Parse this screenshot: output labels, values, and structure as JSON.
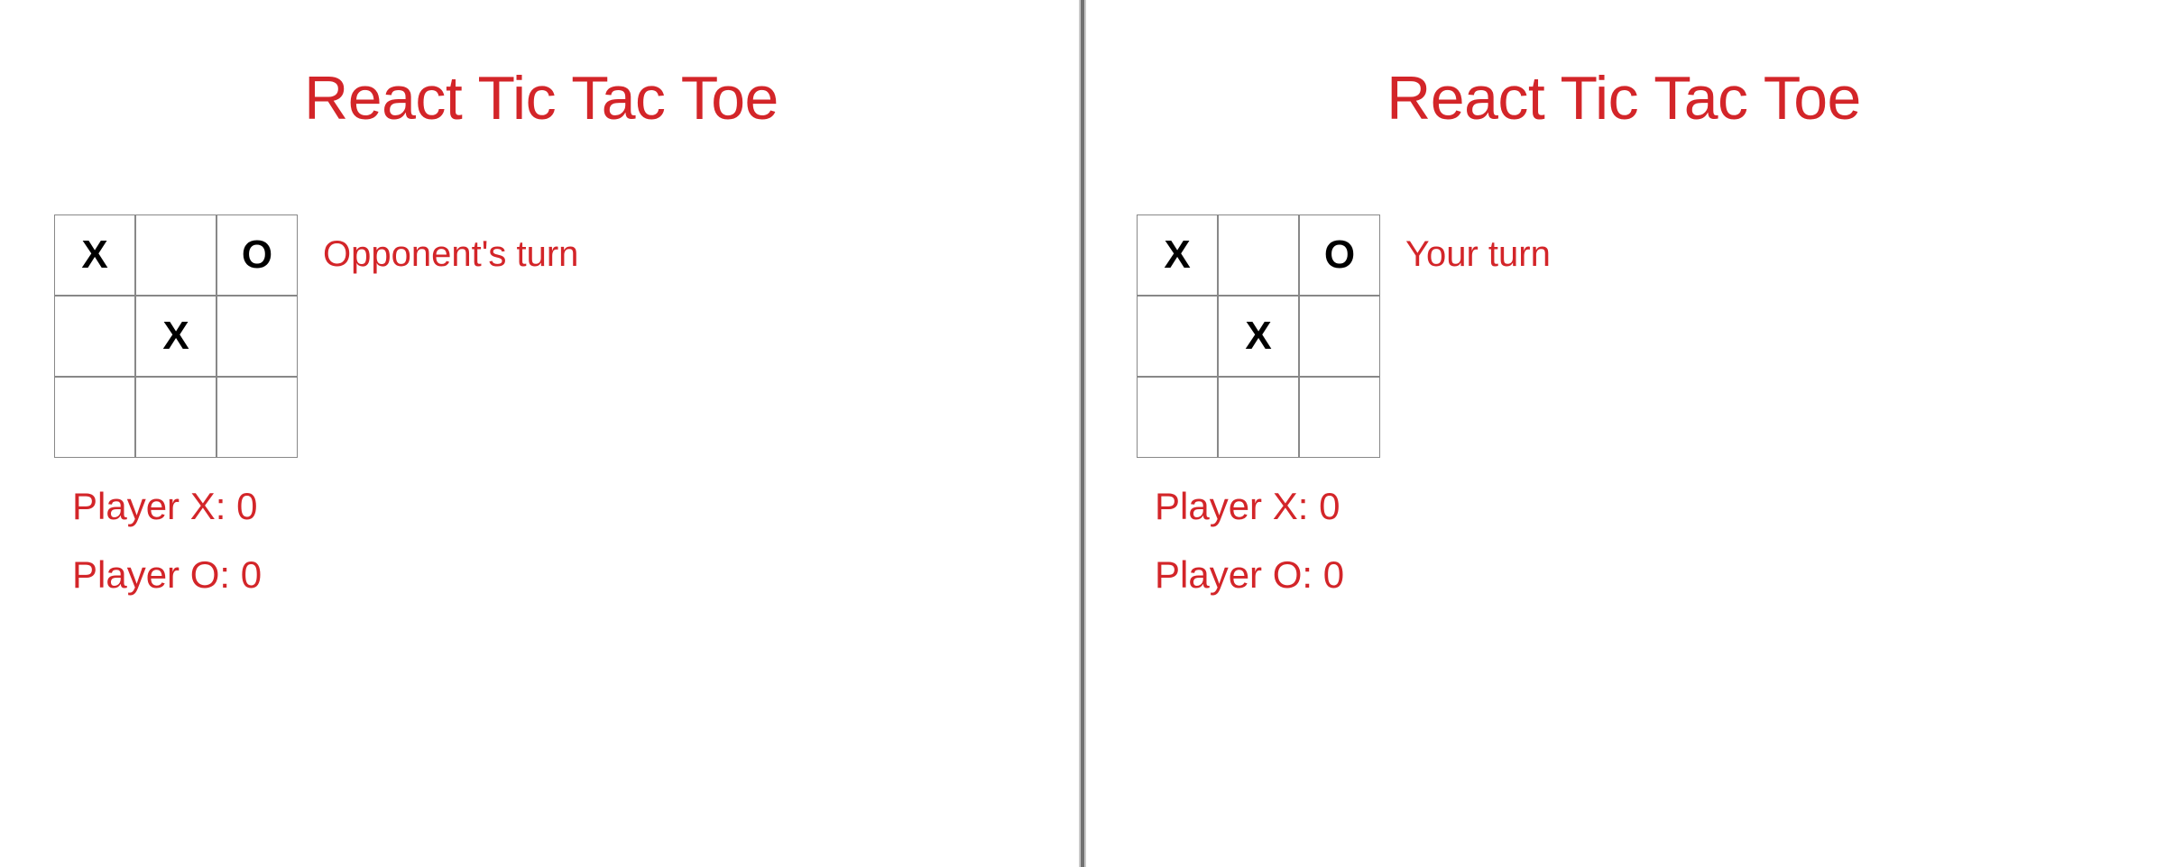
{
  "left": {
    "title": "React Tic Tac Toe",
    "board": [
      [
        "X",
        "",
        "O"
      ],
      [
        "",
        "X",
        ""
      ],
      [
        "",
        "",
        ""
      ]
    ],
    "status": "Opponent's turn",
    "score_x_label": "Player X: 0",
    "score_o_label": "Player O: 0"
  },
  "right": {
    "title": "React Tic Tac Toe",
    "board": [
      [
        "X",
        "",
        "O"
      ],
      [
        "",
        "X",
        ""
      ],
      [
        "",
        "",
        ""
      ]
    ],
    "status": "Your turn",
    "score_x_label": "Player X: 0",
    "score_o_label": "Player O: 0"
  }
}
